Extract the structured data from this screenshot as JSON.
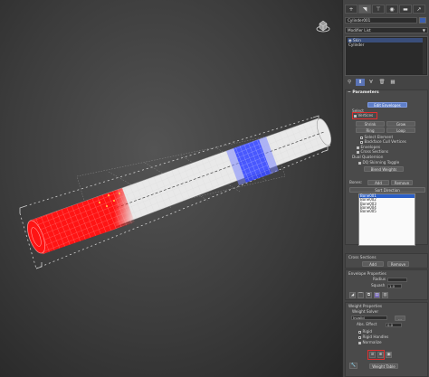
{
  "colors": {
    "weight_red": "#ff1414",
    "weight_blue": "#3b4bff",
    "accent": "#5f7fc8",
    "highlight": "#e03030"
  },
  "tabs": [
    "create-icon",
    "modify-icon",
    "hierarchy-icon",
    "motion-icon",
    "display-icon",
    "utilities-icon"
  ],
  "object": {
    "name": "Cylinder001"
  },
  "modifier_list": {
    "label": "Modifier List"
  },
  "stack": {
    "items": [
      "Skin",
      "Cylinder"
    ]
  },
  "parameters": {
    "title": "Parameters",
    "edit_envelopes": "Edit Envelopes",
    "select_label": "Select",
    "vertices": "Vertices",
    "shrink": "Shrink",
    "grow": "Grow",
    "ring": "Ring",
    "loop": "Loop",
    "select_element": "Select Element",
    "backface_cull": "Backface Cull Vertices",
    "envelopes": "Envelopes",
    "cross_sections": "Cross Sections",
    "dual_quaternion": "Dual Quaternion",
    "dq_skinning": "DQ Skinning Toggle",
    "blend_weights": "Blend Weights",
    "bones_label": "Bones:",
    "add": "Add",
    "remove": "Remove",
    "sort_direction": "Sort Direction",
    "bones": [
      "Bone001",
      "Bone002",
      "Bone003",
      "Bone004",
      "Bone005"
    ]
  },
  "cross_sections": {
    "title": "Cross Sections",
    "add": "Add",
    "remove": "Remove"
  },
  "envelope_properties": {
    "title": "Envelope Properties",
    "radius_label": "Radius",
    "squash_label": "Squash",
    "squash_value": "1.0"
  },
  "weight_properties": {
    "title": "Weight Properties",
    "weight_solver": "Weight Solver",
    "solver_value": "Invalid",
    "abs_effect_label": "Abs. Effect",
    "abs_effect_value": "0.0",
    "rigid": "Rigid",
    "rigid_handles": "Rigid Handles",
    "normalize": "Normalize",
    "weight_table": "Weight Table"
  }
}
